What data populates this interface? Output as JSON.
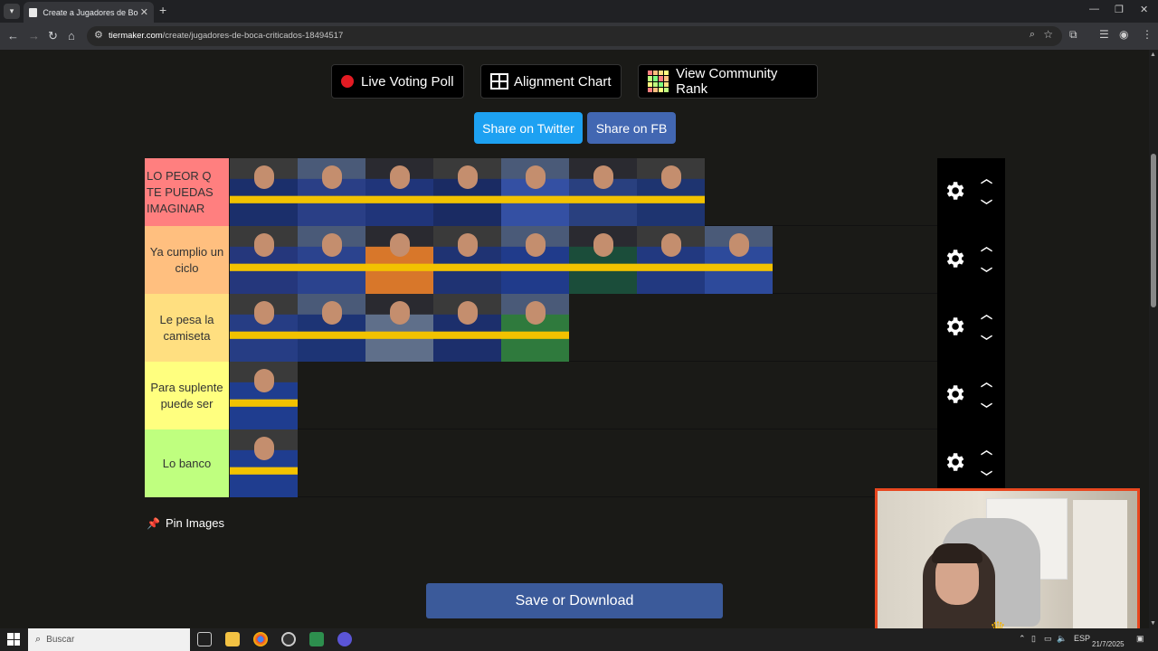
{
  "browser": {
    "tab_title": "Create a Jugadores de Boca Cri",
    "url_domain": "tiermaker.com",
    "url_path": "/create/jugadores-de-boca-criticados-18494517"
  },
  "toolbar": {
    "live_voting": "Live Voting Poll",
    "alignment_chart": "Alignment Chart",
    "community_rank": "View Community Rank",
    "share_twitter": "Share on Twitter",
    "share_fb": "Share on FB"
  },
  "tiers": [
    {
      "label": "LO PEOR Q TE PUEDAS IMAGINAR",
      "color": "#ff7f7f",
      "count": 7
    },
    {
      "label": "Ya cumplio un ciclo",
      "color": "#ffbf7f",
      "count": 8
    },
    {
      "label": "Le pesa la camiseta",
      "color": "#ffdf80",
      "count": 5
    },
    {
      "label": "Para suplente puede ser",
      "color": "#ffff7f",
      "count": 1
    },
    {
      "label": "Lo banco",
      "color": "#bfff7f",
      "count": 1
    }
  ],
  "pin_images": "Pin Images",
  "save_download": "Save or Download",
  "taskbar": {
    "search_placeholder": "Buscar",
    "lang": "ESP",
    "date": "21/7/2025"
  },
  "colors": {
    "twitter": "#1da1f2",
    "facebook": "#4267b2",
    "save": "#3b5a9a",
    "boca_blue": "#1f3d8f",
    "boca_yellow": "#f2c200"
  }
}
